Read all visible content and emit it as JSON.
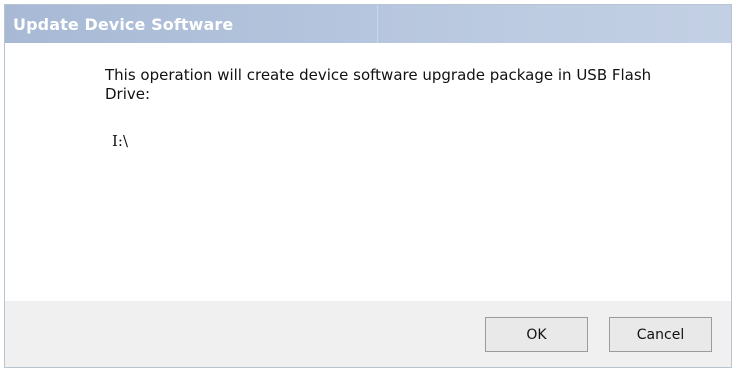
{
  "dialog": {
    "title": "Update Device Software",
    "message": "This operation will create device software upgrade package in USB Flash Drive:",
    "drive_path": "I:\\",
    "ok_label": "OK",
    "cancel_label": "Cancel"
  },
  "colors": {
    "titlebar": "#b3c3dc",
    "title_text": "#ffffff",
    "footer": "#f0f0f0",
    "button_face": "#e9e9e9",
    "button_border": "#9c9c9c"
  }
}
